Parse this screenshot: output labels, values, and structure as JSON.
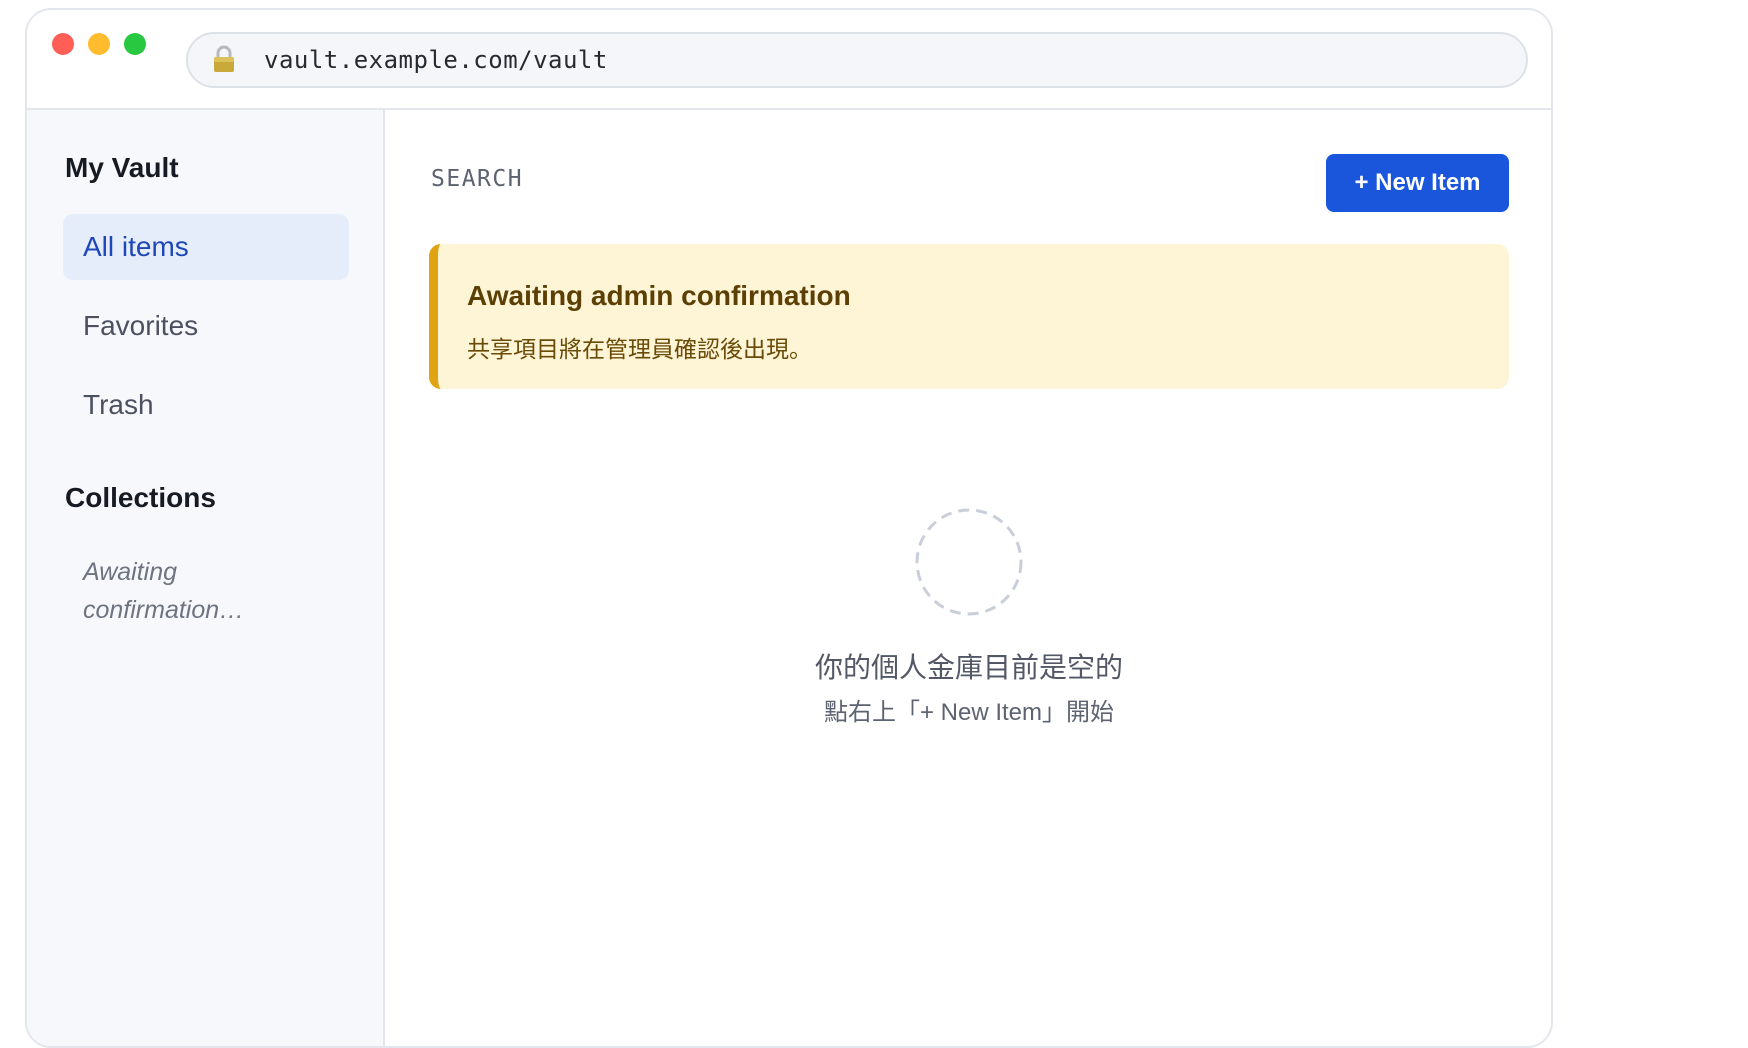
{
  "browser": {
    "url": "vault.example.com/vault"
  },
  "sidebar": {
    "title": "My Vault",
    "items": [
      {
        "label": "All items",
        "active": true
      },
      {
        "label": "Favorites",
        "active": false
      },
      {
        "label": "Trash",
        "active": false
      }
    ],
    "collections_heading": "Collections",
    "collections_placeholder": "Awaiting confirmation…"
  },
  "main": {
    "search_label": "SEARCH",
    "new_item_button": "+ New Item",
    "alert": {
      "title": "Awaiting admin confirmation",
      "body": "共享項目將在管理員確認後出現。"
    },
    "empty_state": {
      "title": "你的個人金庫目前是空的",
      "subtitle": "點右上「+ New Item」開始"
    }
  },
  "colors": {
    "accent": "#1a56db",
    "active_nav_bg": "#e5edfb",
    "alert_bg": "#fef4d6",
    "alert_border": "#e0a412"
  }
}
